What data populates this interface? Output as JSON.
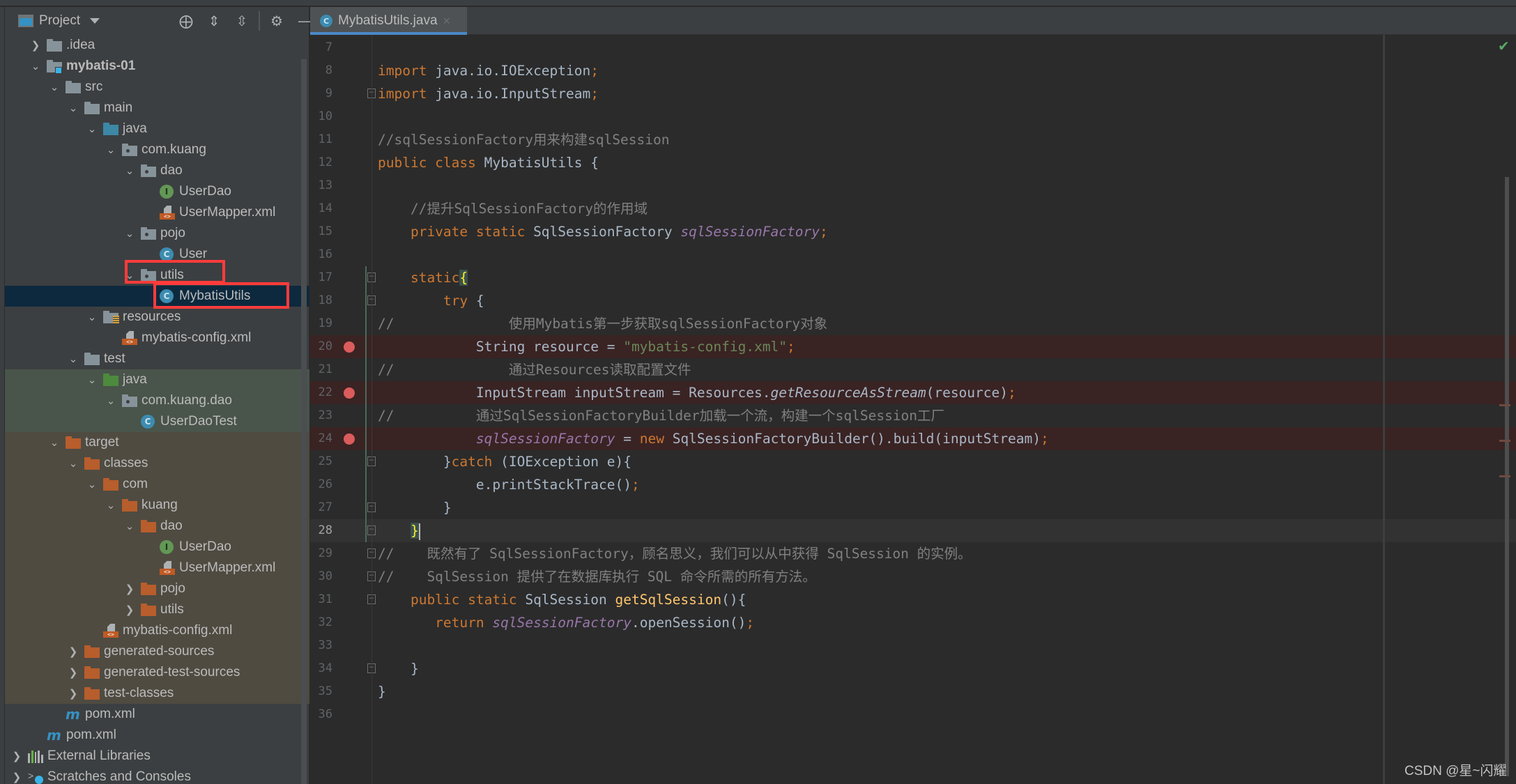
{
  "project_panel": {
    "title": "Project",
    "tools": [
      {
        "name": "locate-icon",
        "glyph": "⨁"
      },
      {
        "name": "expand-all-icon",
        "glyph": "⇕"
      },
      {
        "name": "collapse-all-icon",
        "glyph": "⇳"
      },
      {
        "name": "gear-icon",
        "glyph": "⚙"
      },
      {
        "name": "minimize-icon",
        "glyph": "—"
      }
    ],
    "tree": [
      {
        "label": ".idea"
      },
      {
        "label": "mybatis-01"
      },
      {
        "label": "src"
      },
      {
        "label": "main"
      },
      {
        "label": "java"
      },
      {
        "label": "com.kuang"
      },
      {
        "label": "dao"
      },
      {
        "label": "UserDao"
      },
      {
        "label": "UserMapper.xml"
      },
      {
        "label": "pojo"
      },
      {
        "label": "User"
      },
      {
        "label": "utils"
      },
      {
        "label": "MybatisUtils"
      },
      {
        "label": "resources"
      },
      {
        "label": "mybatis-config.xml"
      },
      {
        "label": "test"
      },
      {
        "label": "java"
      },
      {
        "label": "com.kuang.dao"
      },
      {
        "label": "UserDaoTest"
      },
      {
        "label": "target"
      },
      {
        "label": "classes"
      },
      {
        "label": "com"
      },
      {
        "label": "kuang"
      },
      {
        "label": "dao"
      },
      {
        "label": "UserDao"
      },
      {
        "label": "UserMapper.xml"
      },
      {
        "label": "pojo"
      },
      {
        "label": "utils"
      },
      {
        "label": "mybatis-config.xml"
      },
      {
        "label": "generated-sources"
      },
      {
        "label": "generated-test-sources"
      },
      {
        "label": "test-classes"
      },
      {
        "label": "pom.xml"
      },
      {
        "label": "pom.xml"
      },
      {
        "label": "External Libraries"
      },
      {
        "label": "Scratches and Consoles"
      }
    ],
    "selected": "MybatisUtils",
    "highlighted_items": [
      "utils",
      "MybatisUtils"
    ]
  },
  "editor": {
    "tab": {
      "label": "MybatisUtils.java",
      "close": "×",
      "icon_letter": "C"
    },
    "status_icon": "✔",
    "lines": [
      {
        "n": "7"
      },
      {
        "n": "8",
        "parts": [
          [
            "kw",
            "import "
          ],
          [
            "",
            "java.io.IOException"
          ],
          [
            "semi",
            ";"
          ]
        ]
      },
      {
        "n": "9",
        "parts": [
          [
            "kw",
            "import "
          ],
          [
            "",
            "java.io.InputStream"
          ],
          [
            "semi",
            ";"
          ]
        ]
      },
      {
        "n": "10"
      },
      {
        "n": "11",
        "parts": [
          [
            "cm",
            "//sqlSessionFactory用来构建sqlSession"
          ]
        ]
      },
      {
        "n": "12",
        "parts": [
          [
            "kw",
            "public class "
          ],
          [
            "",
            "MybatisUtils {"
          ]
        ]
      },
      {
        "n": "13"
      },
      {
        "n": "14",
        "parts": [
          [
            "cm",
            "    //提升SqlSessionFactory的作用域"
          ]
        ]
      },
      {
        "n": "15",
        "parts": [
          [
            "kw",
            "    private static "
          ],
          [
            "",
            "SqlSessionFactory "
          ],
          [
            "fld",
            "sqlSessionFactory"
          ],
          [
            "semi",
            ";"
          ]
        ]
      },
      {
        "n": "16"
      },
      {
        "n": "17",
        "parts": [
          [
            "kw",
            "    static"
          ],
          [
            "brace-hl",
            "{"
          ]
        ]
      },
      {
        "n": "18",
        "parts": [
          [
            "kw",
            "        try "
          ],
          [
            "",
            "{"
          ]
        ]
      },
      {
        "n": "19",
        "parts": [
          [
            "cm",
            "//              使用Mybatis第一步获取sqlSessionFactory对象"
          ]
        ]
      },
      {
        "n": "20",
        "breakpoint": true,
        "parts": [
          [
            "",
            "            String resource = "
          ],
          [
            "str",
            "\"mybatis-config.xml\""
          ],
          [
            "semi",
            ";"
          ]
        ]
      },
      {
        "n": "21",
        "parts": [
          [
            "cm",
            "//              通过Resources读取配置文件"
          ]
        ]
      },
      {
        "n": "22",
        "breakpoint": true,
        "parts": [
          [
            "",
            "            InputStream inputStream = Resources."
          ],
          [
            "ital",
            "getResourceAsStream"
          ],
          [
            "",
            "(resource)"
          ],
          [
            "semi",
            ";"
          ]
        ]
      },
      {
        "n": "23",
        "parts": [
          [
            "cm",
            "//          通过SqlSessionFactoryBuilder加载一个流，构建一个sqlSession工厂"
          ]
        ]
      },
      {
        "n": "24",
        "breakpoint": true,
        "parts": [
          [
            "",
            "            "
          ],
          [
            "fld",
            "sqlSessionFactory"
          ],
          [
            "",
            " = "
          ],
          [
            "kw",
            "new "
          ],
          [
            "",
            "SqlSessionFactoryBuilder().build(inputStream)"
          ],
          [
            "semi",
            ";"
          ]
        ]
      },
      {
        "n": "25",
        "parts": [
          [
            "",
            "        }"
          ],
          [
            "kw",
            "catch "
          ],
          [
            "",
            "(IOException e){"
          ]
        ]
      },
      {
        "n": "26",
        "parts": [
          [
            "",
            "            e.printStackTrace()"
          ],
          [
            "semi",
            ";"
          ]
        ]
      },
      {
        "n": "27",
        "parts": [
          [
            "",
            "        }"
          ]
        ]
      },
      {
        "n": "28",
        "current": true,
        "parts": [
          [
            "",
            "    "
          ],
          [
            "brace-hl",
            "}"
          ]
        ]
      },
      {
        "n": "29",
        "parts": [
          [
            "cm",
            "//    既然有了 SqlSessionFactory，顾名思义，我们可以从中获得 SqlSession 的实例。"
          ]
        ]
      },
      {
        "n": "30",
        "parts": [
          [
            "cm",
            "//    SqlSession 提供了在数据库执行 SQL 命令所需的所有方法。"
          ]
        ]
      },
      {
        "n": "31",
        "parts": [
          [
            "kw",
            "    public static "
          ],
          [
            "",
            "SqlSession "
          ],
          [
            "mth",
            "getSqlSession"
          ],
          [
            "",
            "(){"
          ]
        ]
      },
      {
        "n": "32",
        "parts": [
          [
            "kw",
            "       return "
          ],
          [
            "fld",
            "sqlSessionFactory"
          ],
          [
            "",
            ".openSession()"
          ],
          [
            "semi",
            ";"
          ]
        ]
      },
      {
        "n": "33"
      },
      {
        "n": "34",
        "parts": [
          [
            "",
            "    }"
          ]
        ]
      },
      {
        "n": "35",
        "parts": [
          [
            "",
            "}"
          ]
        ]
      },
      {
        "n": "36"
      }
    ]
  },
  "watermark": "CSDN @星~闪耀"
}
